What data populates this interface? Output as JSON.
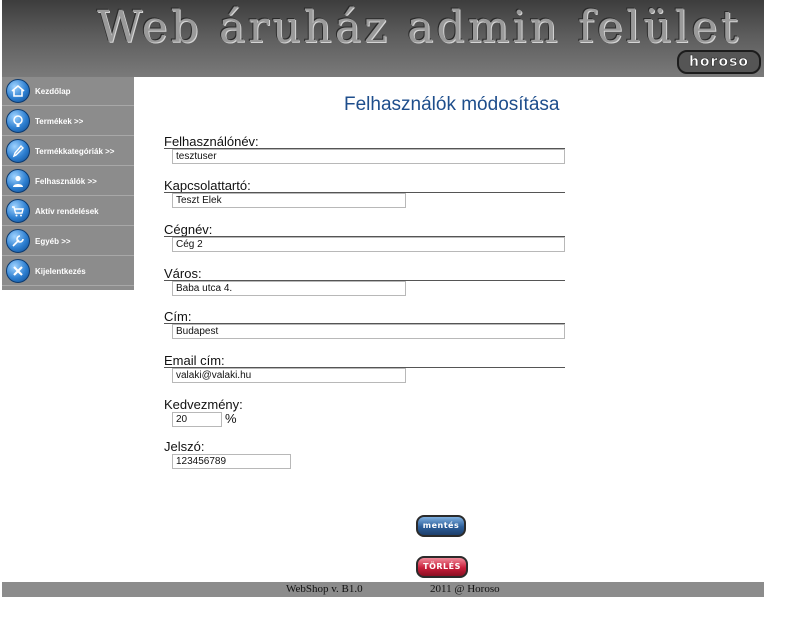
{
  "header": {
    "title": "Web áruház admin felület",
    "logo_text": "horoso"
  },
  "sidebar": {
    "items": [
      {
        "label": "Kezdőlap",
        "icon": "home-icon"
      },
      {
        "label": "Termékek >>",
        "icon": "lightbulb-icon"
      },
      {
        "label": "Termékkategóriák >>",
        "icon": "pen-icon"
      },
      {
        "label": "Felhasználók >>",
        "icon": "users-icon"
      },
      {
        "label": "Aktív rendelések",
        "icon": "cart-icon"
      },
      {
        "label": "Egyéb >>",
        "icon": "wrench-icon"
      },
      {
        "label": "Kijelentkezés",
        "icon": "close-icon"
      }
    ]
  },
  "form": {
    "title": "Felhasználók módosítása",
    "fields": {
      "username": {
        "label": "Felhasználónév:",
        "value": "tesztuser"
      },
      "contact": {
        "label": "Kapcsolattartó:",
        "value": "Teszt Elek"
      },
      "company": {
        "label": "Cégnév:",
        "value": "Cég 2"
      },
      "city": {
        "label": "Város:",
        "value": "Baba utca 4."
      },
      "address": {
        "label": "Cím:",
        "value": "Budapest"
      },
      "email": {
        "label": "Email cím:",
        "value": "valaki@valaki.hu"
      },
      "discount": {
        "label": "Kedvezmény:",
        "value": "20",
        "unit": "%"
      },
      "password": {
        "label": "Jelszó:",
        "value": "123456789"
      }
    },
    "save_label": "mentés",
    "delete_label": "TÖRLÉS"
  },
  "footer": {
    "version": "WebShop v. B1.0",
    "copyright": "2011 @ Horoso"
  },
  "colors": {
    "title_blue": "#1e4e8c",
    "sidebar_gray": "#8c8c8c",
    "save_blue": "#2c5e9a",
    "delete_red": "#c81e3a"
  }
}
